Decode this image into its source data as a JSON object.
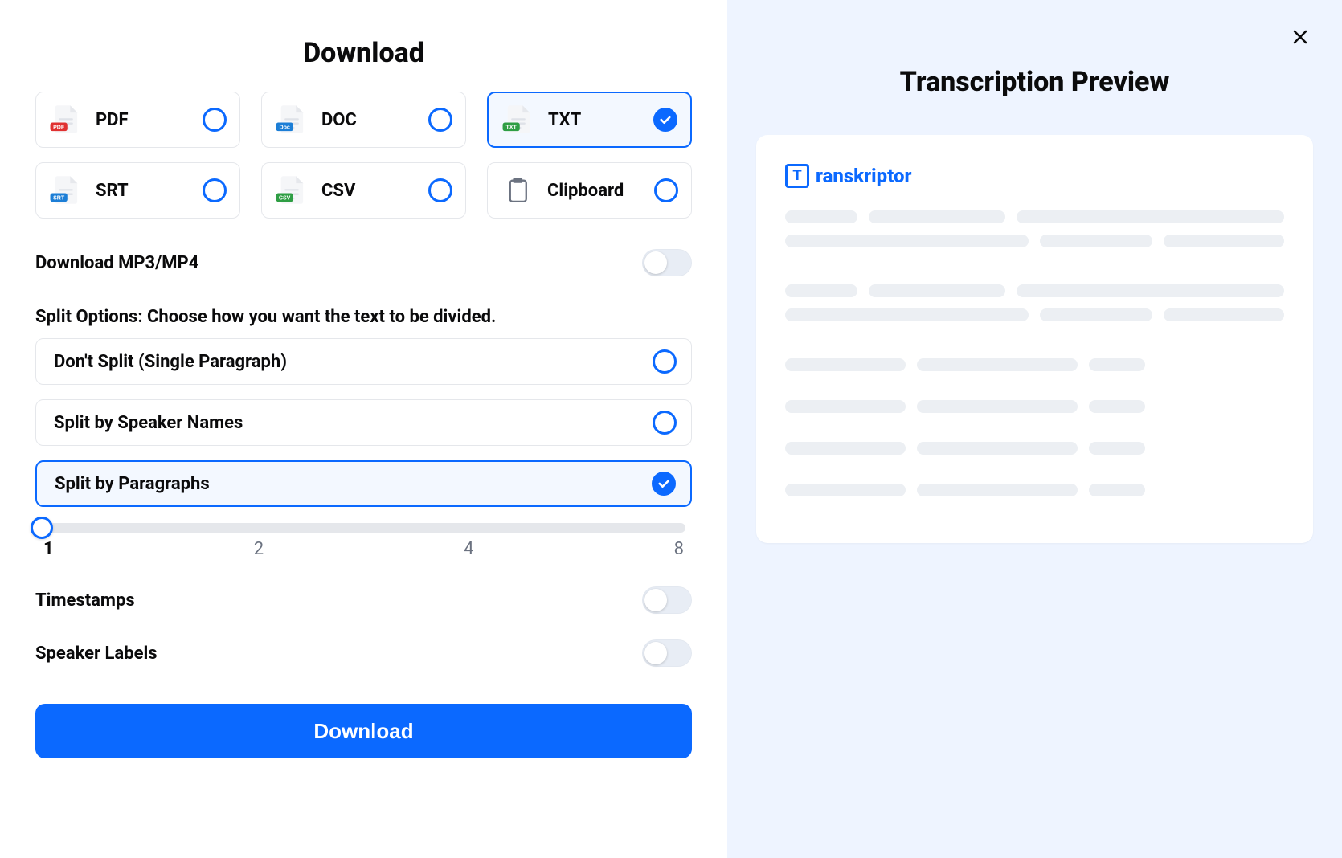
{
  "title": "Download",
  "formats": [
    {
      "label": "PDF",
      "badge": "PDF",
      "badgeColor": "#e03131",
      "selected": false
    },
    {
      "label": "DOC",
      "badge": "Doc",
      "badgeColor": "#1c7ed6",
      "selected": false
    },
    {
      "label": "TXT",
      "badge": "TXT",
      "badgeColor": "#2f9e44",
      "selected": true
    },
    {
      "label": "SRT",
      "badge": "SRT",
      "badgeColor": "#1c7ed6",
      "selected": false
    },
    {
      "label": "CSV",
      "badge": "CSV",
      "badgeColor": "#2f9e44",
      "selected": false
    },
    {
      "label": "Clipboard",
      "badge": "",
      "badgeColor": "",
      "selected": false
    }
  ],
  "options": {
    "mp3mp4_label": "Download MP3/MP4",
    "mp3mp4_on": false,
    "split_heading": "Split Options: Choose how you want the text to be divided.",
    "split": [
      {
        "label": "Don't Split (Single Paragraph)",
        "selected": false
      },
      {
        "label": "Split by Speaker Names",
        "selected": false
      },
      {
        "label": "Split by Paragraphs",
        "selected": true
      }
    ],
    "slider": {
      "value": 1,
      "ticks": [
        1,
        2,
        4,
        8
      ]
    },
    "timestamps_label": "Timestamps",
    "timestamps_on": false,
    "speaker_labels_label": "Speaker Labels",
    "speaker_labels_on": false
  },
  "download_button": "Download",
  "preview": {
    "title": "Transcription Preview",
    "brand": "ranskriptor",
    "brand_letter": "T"
  }
}
